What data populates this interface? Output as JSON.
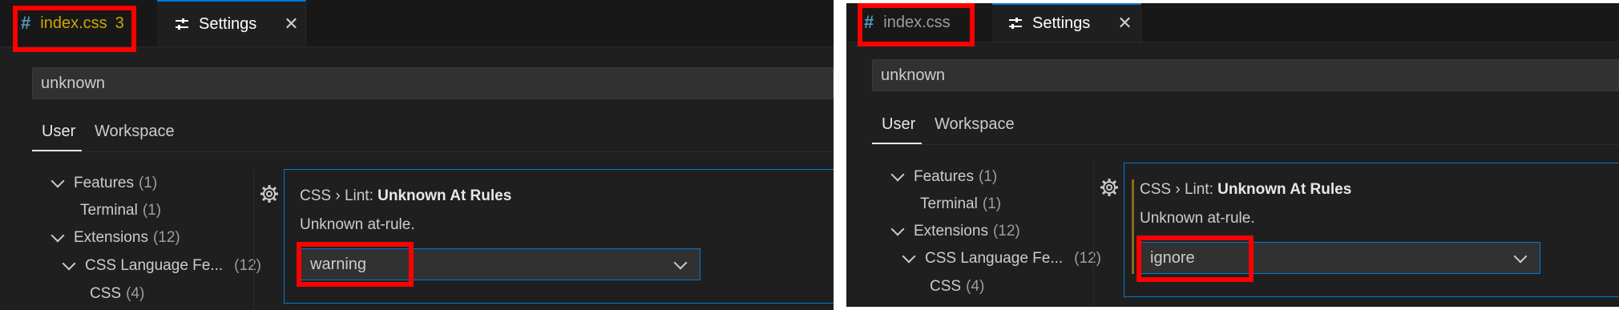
{
  "left": {
    "tab_file": {
      "icon": "#",
      "label": "index.css",
      "problems": "3"
    },
    "tab_settings": {
      "label": "Settings",
      "close": "✕"
    },
    "search": {
      "value": "unknown"
    },
    "scope_tabs": [
      "User",
      "Workspace"
    ],
    "tree": [
      {
        "label": "Features",
        "count": "(1)",
        "expanded": true
      },
      {
        "label": "Terminal",
        "count": "(1)"
      },
      {
        "label": "Extensions",
        "count": "(12)",
        "expanded": true
      },
      {
        "label": "CSS Language Fe...",
        "count": "(12)",
        "expanded": true
      },
      {
        "label": "CSS",
        "count": "(4)"
      }
    ],
    "setting": {
      "prefix": "CSS › Lint: ",
      "name": "Unknown At Rules",
      "description": "Unknown at-rule.",
      "value": "warning"
    }
  },
  "right": {
    "tab_file": {
      "icon": "#",
      "label": "index.css"
    },
    "tab_settings": {
      "label": "Settings",
      "close": "✕"
    },
    "search": {
      "value": "unknown"
    },
    "scope_tabs": [
      "User",
      "Workspace"
    ],
    "tree": [
      {
        "label": "Features",
        "count": "(1)",
        "expanded": true
      },
      {
        "label": "Terminal",
        "count": "(1)"
      },
      {
        "label": "Extensions",
        "count": "(12)",
        "expanded": true
      },
      {
        "label": "CSS Language Fe...",
        "count": "(12)",
        "expanded": true
      },
      {
        "label": "CSS",
        "count": "(4)"
      }
    ],
    "setting": {
      "prefix": "CSS › Lint: ",
      "name": "Unknown At Rules",
      "description": "Unknown at-rule.",
      "value": "ignore"
    }
  },
  "colors": {
    "highlight": "#ff0000",
    "focus_border": "#0078d4",
    "warning": "#cca700",
    "css_icon": "#519aba"
  },
  "icons": [
    "hash-icon",
    "settings-sliders-icon",
    "close-icon",
    "chevron-down-icon",
    "gear-icon"
  ]
}
